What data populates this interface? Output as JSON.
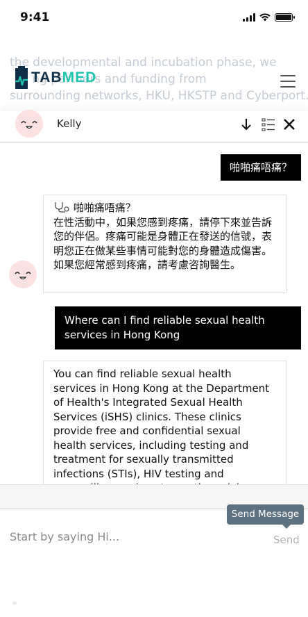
{
  "status_bar": {
    "time": "9:41",
    "battery_level": 1.0,
    "signal_bars": 4
  },
  "site": {
    "logo_text_1": "TAB",
    "logo_text_2": "MED",
    "background_text": [
      "the developmental and incubation phase, we",
      "      ng partners and funding from",
      "surrounding networks, HKU, HKSTP and Cyberport."
    ],
    "menu_icon": "hamburger-menu-icon"
  },
  "chat": {
    "agent_name": "Kelly",
    "header_icons": [
      "arrow-down-icon",
      "list-icon",
      "close-icon"
    ],
    "messages": [
      {
        "role": "user",
        "text": "啪啪痛唔痛？"
      },
      {
        "role": "bot",
        "icon": "stethoscope-icon",
        "title": "啪啪痛唔痛？",
        "text": "在性活動中，如果您感到疼痛，請停下來並告訴您的伴侶。疼痛可能是身體正在發送的信號，表明您正在做某些事情可能對您的身體造成傷害。如果您經常感到疼痛，請考慮咨詢醫生。"
      },
      {
        "role": "user",
        "text": "Where can I find reliable sexual health services in Hong Kong"
      },
      {
        "role": "bot",
        "text": "You can find reliable sexual health services in Hong Kong at the Department of Health's Integrated Sexual Health Services (iSHS) clinics. These clinics provide free and confidential sexual health services, including testing and treatment for sexually transmitted infections (STIs), HIV testing and counselling, and contraception advice."
      }
    ],
    "input": {
      "placeholder": "Start by saying Hi...",
      "value": ""
    },
    "send_label": "Send",
    "tooltip": "Send Message"
  },
  "colors": {
    "brand_dark": "#0f2e47",
    "brand_accent": "#1ec4ac",
    "tooltip_bg": "#5e7180",
    "user_bubble": "#000000"
  }
}
